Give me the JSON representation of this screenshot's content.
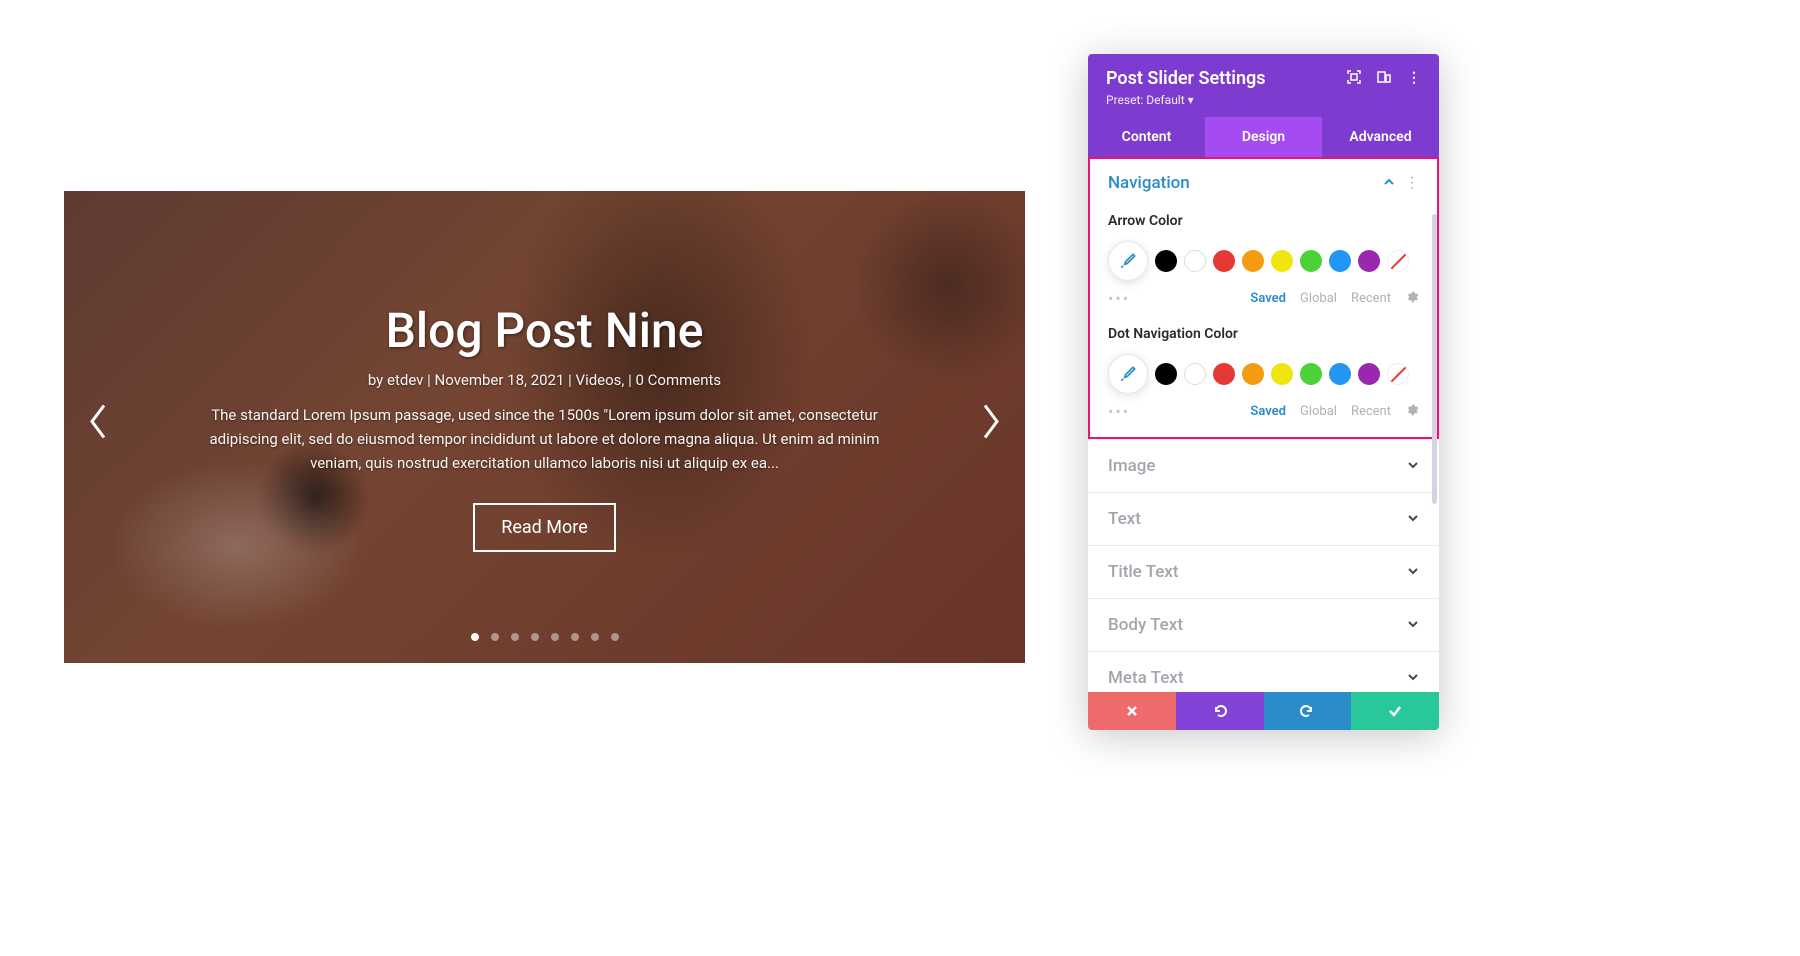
{
  "slider": {
    "title": "Blog Post Nine",
    "meta": "by etdev | November 18, 2021 | Videos, | 0 Comments",
    "desc": "The standard Lorem Ipsum passage, used since the 1500s \"Lorem ipsum dolor sit amet, consectetur adipiscing elit, sed do eiusmod tempor incididunt ut labore et dolore magna aliqua. Ut enim ad minim veniam, quis nostrud exercitation ullamco laboris nisi ut aliquip ex ea...",
    "button": "Read More",
    "dot_count": 8,
    "active_dot": 0
  },
  "panel": {
    "title": "Post Slider Settings",
    "preset": "Preset: Default ▾",
    "tabs": {
      "content": "Content",
      "design": "Design",
      "advanced": "Advanced"
    },
    "navigation": {
      "label": "Navigation",
      "arrow_label": "Arrow Color",
      "dot_label": "Dot Navigation Color",
      "palette_tabs": {
        "saved": "Saved",
        "global": "Global",
        "recent": "Recent"
      },
      "swatches": [
        "#000000",
        "outline",
        "#e53935",
        "#f39c12",
        "#f1e50f",
        "#4cd137",
        "#2196f3",
        "#9b27b0",
        "none"
      ]
    },
    "sections": {
      "image": "Image",
      "text": "Text",
      "title_text": "Title Text",
      "body_text": "Body Text",
      "meta_text": "Meta Text"
    }
  }
}
